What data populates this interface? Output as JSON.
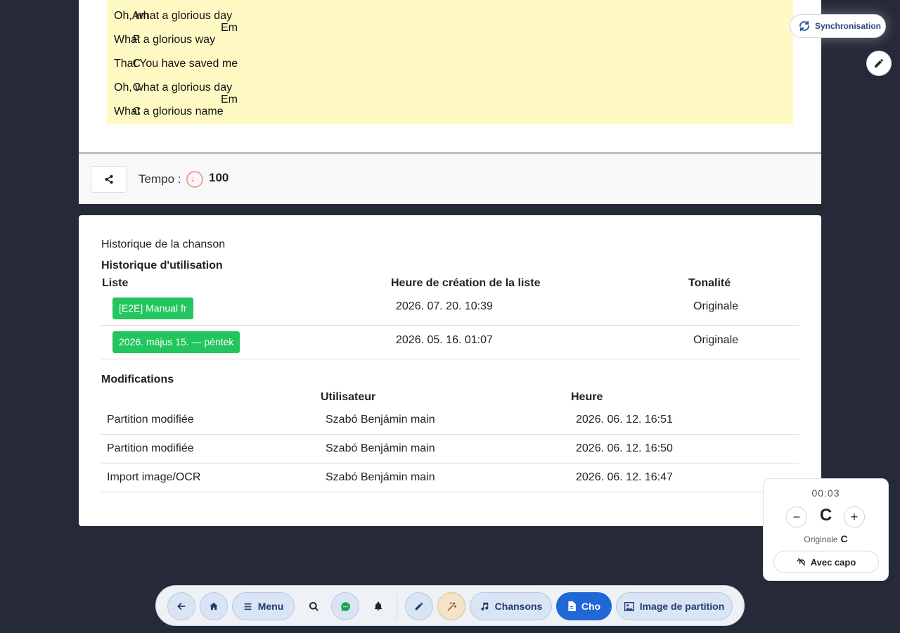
{
  "lyrics": {
    "lines": [
      {
        "chord1": "Am",
        "chord2": "Em"
      },
      {
        "text": "Oh, what a glorious day"
      },
      {
        "chord1": "F"
      },
      {
        "text": "What a glorious way"
      },
      {
        "chord1": "C"
      },
      {
        "text": "That You have saved me"
      },
      {
        "chord1": "C",
        "chord2": "Em"
      },
      {
        "text": "Oh, what a glorious day"
      },
      {
        "chord1": "C"
      },
      {
        "text": "What a glorious name"
      }
    ]
  },
  "sync": {
    "label": "Synchronisation"
  },
  "tempo": {
    "label": "Tempo :",
    "value": "100",
    "metronome_glyph": "♩"
  },
  "history": {
    "title": "Historique de la chanson",
    "usage": {
      "title": "Historique d'utilisation",
      "headers": {
        "list": "Liste",
        "created": "Heure de création de la liste",
        "key": "Tonalité"
      },
      "rows": [
        {
          "list": "[E2E] Manual fr",
          "created": "2026. 07. 20. 10:39",
          "key": "Originale"
        },
        {
          "list": "2026. május 15. — péntek",
          "created": "2026. 05. 16. 01:07",
          "key": "Originale"
        }
      ]
    },
    "modifications": {
      "title": "Modifications",
      "headers": {
        "action": "",
        "user": "Utilisateur",
        "time": "Heure"
      },
      "rows": [
        {
          "action": "Partition modifiée",
          "user": "Szabó Benjámin main",
          "time": "2026. 06. 12. 16:51"
        },
        {
          "action": "Partition modifiée",
          "user": "Szabó Benjámin main",
          "time": "2026. 06. 12. 16:50"
        },
        {
          "action": "Import image/OCR",
          "user": "Szabó Benjámin main",
          "time": "2026. 06. 12. 16:47"
        }
      ]
    }
  },
  "transpose": {
    "timer": "00:03",
    "current_key": "C",
    "original_label": "Originale",
    "original_key": "C",
    "capo_label": "Avec capo",
    "minus": "−",
    "plus": "+"
  },
  "toolbar": {
    "menu_label": "Menu",
    "songs_label": "Chansons",
    "cho_label": "Cho",
    "sheet_image_label": "Image de partition"
  },
  "colors": {
    "background": "#262a38",
    "lyrics_bg": "#fff9c4",
    "badge_green": "#22c55e",
    "active_blue": "#1f68d6"
  }
}
